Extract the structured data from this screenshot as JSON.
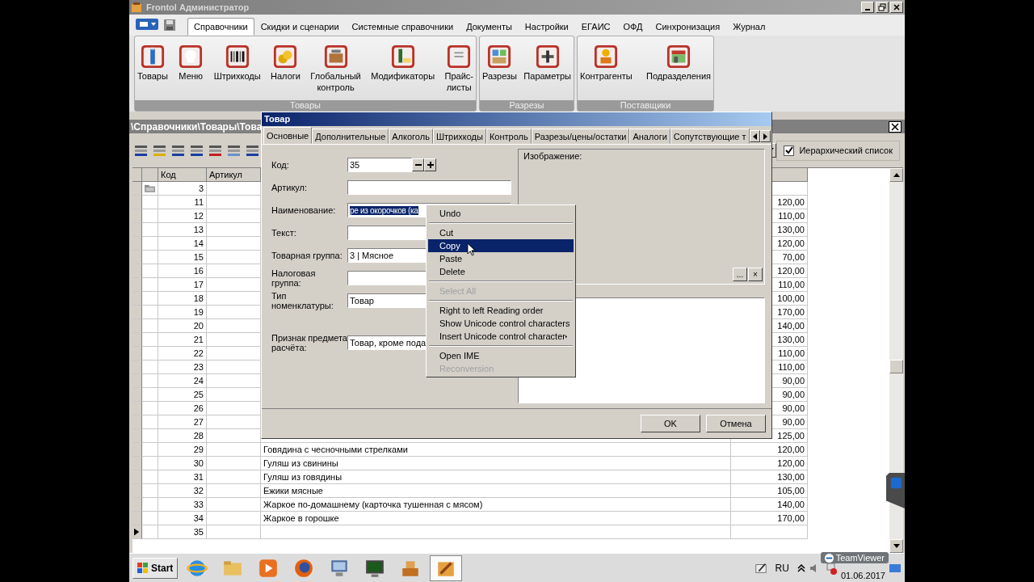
{
  "window": {
    "title": "Frontol Администратор"
  },
  "menu_tabs": [
    {
      "label": "Справочники",
      "selected": true
    },
    {
      "label": "Скидки и сценарии",
      "selected": false
    },
    {
      "label": "Системные справочники",
      "selected": false
    },
    {
      "label": "Документы",
      "selected": false
    },
    {
      "label": "Настройки",
      "selected": false
    },
    {
      "label": "ЕГАИС",
      "selected": false
    },
    {
      "label": "ОФД",
      "selected": false
    },
    {
      "label": "Синхронизация",
      "selected": false
    },
    {
      "label": "Журнал",
      "selected": false
    }
  ],
  "ribbon_groups": [
    {
      "title": "Товары",
      "items": [
        "Товары",
        "Меню",
        "Штрихкоды",
        "Налоги",
        "Глобальный контроль",
        "Модификаторы",
        "Прайс-листы"
      ]
    },
    {
      "title": "Разрезы",
      "items": [
        "Разрезы",
        "Параметры"
      ]
    },
    {
      "title": "Поставщики",
      "items": [
        "Контрагенты",
        "Подразделения"
      ]
    }
  ],
  "pane": {
    "path": "\\Справочники\\Товары\\Това",
    "hierarchy_checkbox": {
      "label": "Иерархический список",
      "checked": true
    }
  },
  "table": {
    "columns": [
      "Код",
      "Артикул"
    ],
    "rows": [
      {
        "code": "3",
        "kind": "group",
        "selected": false
      },
      {
        "code": "11",
        "price": "120,00",
        "kind": "item",
        "selected": false
      },
      {
        "code": "12",
        "price": "110,00",
        "kind": "item",
        "selected": false
      },
      {
        "code": "13",
        "price": "130,00",
        "kind": "item",
        "selected": false
      },
      {
        "code": "14",
        "price": "120,00",
        "kind": "item",
        "selected": false
      },
      {
        "code": "15",
        "price": "70,00",
        "kind": "item",
        "selected": false
      },
      {
        "code": "16",
        "price": "120,00",
        "kind": "item",
        "selected": false
      },
      {
        "code": "17",
        "price": "110,00",
        "kind": "item",
        "selected": false
      },
      {
        "code": "18",
        "price": "100,00",
        "kind": "item",
        "selected": false
      },
      {
        "code": "19",
        "price": "170,00",
        "kind": "item",
        "selected": false
      },
      {
        "code": "20",
        "price": "140,00",
        "kind": "item",
        "selected": false
      },
      {
        "code": "21",
        "price": "130,00",
        "kind": "item",
        "selected": false
      },
      {
        "code": "22",
        "price": "110,00",
        "kind": "item",
        "selected": false
      },
      {
        "code": "23",
        "price": "110,00",
        "kind": "item",
        "selected": false
      },
      {
        "code": "24",
        "price": "90,00",
        "kind": "item",
        "selected": false
      },
      {
        "code": "25",
        "price": "90,00",
        "kind": "item",
        "selected": false
      },
      {
        "code": "26",
        "price": "90,00",
        "kind": "item",
        "selected": false
      },
      {
        "code": "27",
        "price": "90,00",
        "kind": "item",
        "selected": false
      },
      {
        "code": "28",
        "price": "125,00",
        "kind": "item",
        "selected": false
      },
      {
        "code": "29",
        "name": "Говядина с чесночными стрелками",
        "price": "120,00",
        "kind": "item",
        "selected": false
      },
      {
        "code": "30",
        "name": "Гуляш из свинины",
        "price": "120,00",
        "kind": "item",
        "selected": false
      },
      {
        "code": "31",
        "name": "Гуляш из говядины",
        "price": "130,00",
        "kind": "item",
        "selected": false
      },
      {
        "code": "32",
        "name": "Ежики мясные",
        "price": "105,00",
        "kind": "item",
        "selected": false
      },
      {
        "code": "33",
        "name": "Жаркое по-домашнему (карточка тушенная с мясом)",
        "price": "140,00",
        "kind": "item",
        "selected": false
      },
      {
        "code": "34",
        "name": "Жаркое в горошке",
        "price": "170,00",
        "kind": "item",
        "selected": false
      },
      {
        "code": "35",
        "kind": "item",
        "selected": true
      }
    ]
  },
  "dialog": {
    "title": "Товар",
    "tabs": [
      {
        "label": "Основные",
        "selected": true
      },
      {
        "label": "Дополнительные",
        "selected": false
      },
      {
        "label": "Алкоголь",
        "selected": false
      },
      {
        "label": "Штрихкоды",
        "selected": false
      },
      {
        "label": "Контроль",
        "selected": false
      },
      {
        "label": "Разрезы/цены/остатки",
        "selected": false
      },
      {
        "label": "Аналоги",
        "selected": false
      },
      {
        "label": "Сопутствующие т",
        "selected": false
      }
    ],
    "fields": [
      {
        "label": "Код:",
        "value": "35",
        "kind": "spinner"
      },
      {
        "label": "Артикул:",
        "kind": "text"
      },
      {
        "label": "Наименование:",
        "value": "ре из окорочков (ка",
        "kind": "highlighted"
      },
      {
        "label": "Текст:",
        "kind": "text"
      },
      {
        "label": "Товарная группа:",
        "value": "3 | Мясное",
        "kind": "text"
      },
      {
        "label": "Налоговая группа:",
        "kind": "text"
      },
      {
        "label": "Тип номенклатуры:",
        "value": "Товар",
        "kind": "text"
      },
      {
        "label": "Признак предмета расчёта:",
        "value": "Товар, кроме пода",
        "kind": "text"
      }
    ],
    "image_label": "Изображение:",
    "image_buttons": [
      "...",
      "×"
    ],
    "buttons": [
      "OK",
      "Отмена"
    ]
  },
  "context_menu": [
    {
      "kind": "item",
      "label": "Undo",
      "selected": false,
      "disabled": false,
      "submenu": false
    },
    {
      "kind": "separator"
    },
    {
      "kind": "item",
      "label": "Cut",
      "selected": false,
      "disabled": false,
      "submenu": false
    },
    {
      "kind": "item",
      "label": "Copy",
      "selected": true,
      "disabled": false,
      "submenu": false
    },
    {
      "kind": "item",
      "label": "Paste",
      "selected": false,
      "disabled": false,
      "submenu": false
    },
    {
      "kind": "item",
      "label": "Delete",
      "selected": false,
      "disabled": false,
      "submenu": false
    },
    {
      "kind": "separator"
    },
    {
      "kind": "item",
      "label": "Select All",
      "selected": false,
      "disabled": true,
      "submenu": false
    },
    {
      "kind": "separator"
    },
    {
      "kind": "item",
      "label": "Right to left Reading order",
      "selected": false,
      "disabled": false,
      "submenu": false
    },
    {
      "kind": "item",
      "label": "Show Unicode control characters",
      "selected": false,
      "disabled": false,
      "submenu": false
    },
    {
      "kind": "item",
      "label": "Insert Unicode control character",
      "selected": false,
      "disabled": false,
      "submenu": true
    },
    {
      "kind": "separator"
    },
    {
      "kind": "item",
      "label": "Open IME",
      "selected": false,
      "disabled": false,
      "submenu": false
    },
    {
      "kind": "item",
      "label": "Reconversion",
      "selected": false,
      "disabled": true,
      "submenu": false
    }
  ],
  "taskbar": {
    "start": "Start",
    "apps": [
      {
        "selected": false
      },
      {
        "selected": false
      },
      {
        "selected": false
      },
      {
        "selected": false
      },
      {
        "selected": false
      },
      {
        "selected": false
      },
      {
        "selected": false
      },
      {
        "selected": true
      }
    ],
    "language": "RU",
    "date": "01.06.2017",
    "remote_badge": "TeamViewer"
  }
}
